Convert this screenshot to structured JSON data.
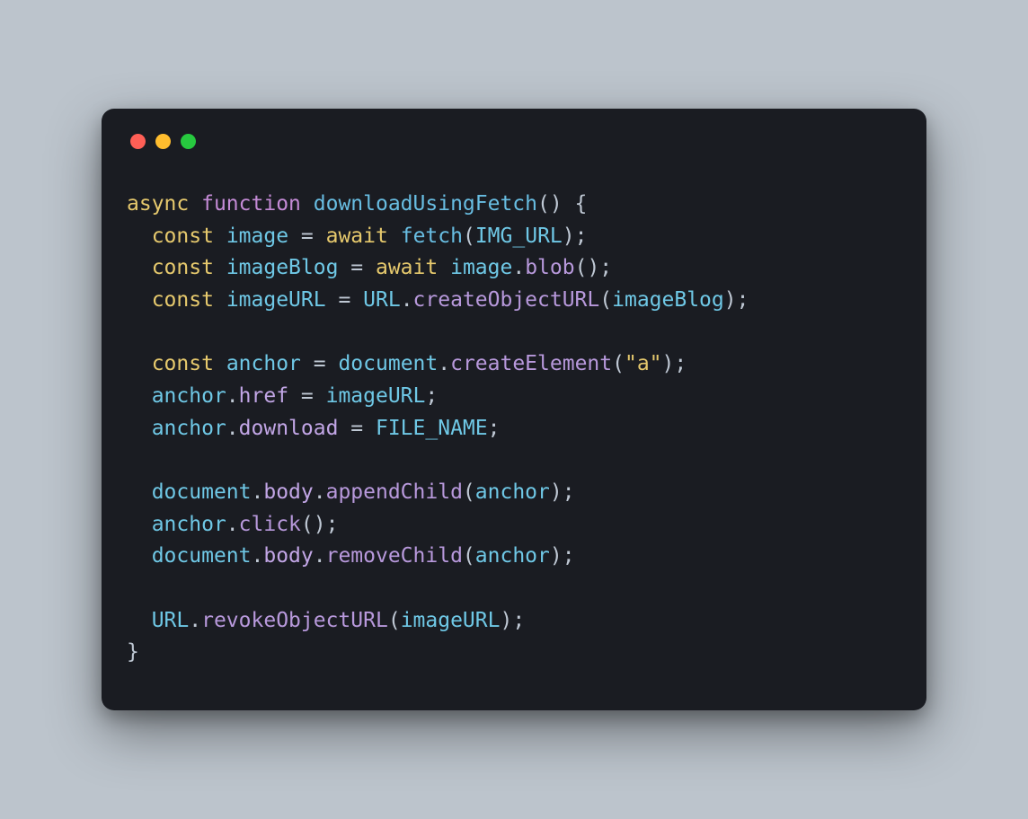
{
  "colors": {
    "background": "#bcc4cc",
    "window": "#1a1c22",
    "red": "#ff5f56",
    "yellow": "#ffbd2e",
    "green": "#27c93f"
  },
  "code": {
    "lines": [
      [
        {
          "t": "async",
          "c": "tok-kw2"
        },
        {
          "t": " ",
          "c": "tok-punc"
        },
        {
          "t": "function",
          "c": "tok-kw"
        },
        {
          "t": " ",
          "c": "tok-punc"
        },
        {
          "t": "downloadUsingFetch",
          "c": "tok-func"
        },
        {
          "t": "() {",
          "c": "tok-punc"
        }
      ],
      [
        {
          "t": "  ",
          "c": "tok-punc"
        },
        {
          "t": "const",
          "c": "tok-kw2"
        },
        {
          "t": " ",
          "c": "tok-punc"
        },
        {
          "t": "image",
          "c": "tok-ident"
        },
        {
          "t": " = ",
          "c": "tok-punc"
        },
        {
          "t": "await",
          "c": "tok-kw2"
        },
        {
          "t": " ",
          "c": "tok-punc"
        },
        {
          "t": "fetch",
          "c": "tok-func"
        },
        {
          "t": "(",
          "c": "tok-punc"
        },
        {
          "t": "IMG_URL",
          "c": "tok-const"
        },
        {
          "t": ");",
          "c": "tok-punc"
        }
      ],
      [
        {
          "t": "  ",
          "c": "tok-punc"
        },
        {
          "t": "const",
          "c": "tok-kw2"
        },
        {
          "t": " ",
          "c": "tok-punc"
        },
        {
          "t": "imageBlog",
          "c": "tok-ident"
        },
        {
          "t": " = ",
          "c": "tok-punc"
        },
        {
          "t": "await",
          "c": "tok-kw2"
        },
        {
          "t": " ",
          "c": "tok-punc"
        },
        {
          "t": "image",
          "c": "tok-ident"
        },
        {
          "t": ".",
          "c": "tok-punc"
        },
        {
          "t": "blob",
          "c": "tok-call"
        },
        {
          "t": "();",
          "c": "tok-punc"
        }
      ],
      [
        {
          "t": "  ",
          "c": "tok-punc"
        },
        {
          "t": "const",
          "c": "tok-kw2"
        },
        {
          "t": " ",
          "c": "tok-punc"
        },
        {
          "t": "imageURL",
          "c": "tok-ident"
        },
        {
          "t": " = ",
          "c": "tok-punc"
        },
        {
          "t": "URL",
          "c": "tok-doc"
        },
        {
          "t": ".",
          "c": "tok-punc"
        },
        {
          "t": "createObjectURL",
          "c": "tok-call"
        },
        {
          "t": "(",
          "c": "tok-punc"
        },
        {
          "t": "imageBlog",
          "c": "tok-ident"
        },
        {
          "t": ");",
          "c": "tok-punc"
        }
      ],
      [
        {
          "t": "",
          "c": "tok-punc"
        }
      ],
      [
        {
          "t": "  ",
          "c": "tok-punc"
        },
        {
          "t": "const",
          "c": "tok-kw2"
        },
        {
          "t": " ",
          "c": "tok-punc"
        },
        {
          "t": "anchor",
          "c": "tok-ident"
        },
        {
          "t": " = ",
          "c": "tok-punc"
        },
        {
          "t": "document",
          "c": "tok-doc"
        },
        {
          "t": ".",
          "c": "tok-punc"
        },
        {
          "t": "createElement",
          "c": "tok-call"
        },
        {
          "t": "(",
          "c": "tok-punc"
        },
        {
          "t": "\"a\"",
          "c": "tok-str"
        },
        {
          "t": ");",
          "c": "tok-punc"
        }
      ],
      [
        {
          "t": "  ",
          "c": "tok-punc"
        },
        {
          "t": "anchor",
          "c": "tok-ident"
        },
        {
          "t": ".",
          "c": "tok-punc"
        },
        {
          "t": "href",
          "c": "tok-prop"
        },
        {
          "t": " = ",
          "c": "tok-punc"
        },
        {
          "t": "imageURL",
          "c": "tok-ident"
        },
        {
          "t": ";",
          "c": "tok-punc"
        }
      ],
      [
        {
          "t": "  ",
          "c": "tok-punc"
        },
        {
          "t": "anchor",
          "c": "tok-ident"
        },
        {
          "t": ".",
          "c": "tok-punc"
        },
        {
          "t": "download",
          "c": "tok-prop"
        },
        {
          "t": " = ",
          "c": "tok-punc"
        },
        {
          "t": "FILE_NAME",
          "c": "tok-const"
        },
        {
          "t": ";",
          "c": "tok-punc"
        }
      ],
      [
        {
          "t": "",
          "c": "tok-punc"
        }
      ],
      [
        {
          "t": "  ",
          "c": "tok-punc"
        },
        {
          "t": "document",
          "c": "tok-doc"
        },
        {
          "t": ".",
          "c": "tok-punc"
        },
        {
          "t": "body",
          "c": "tok-prop"
        },
        {
          "t": ".",
          "c": "tok-punc"
        },
        {
          "t": "appendChild",
          "c": "tok-call"
        },
        {
          "t": "(",
          "c": "tok-punc"
        },
        {
          "t": "anchor",
          "c": "tok-ident"
        },
        {
          "t": ");",
          "c": "tok-punc"
        }
      ],
      [
        {
          "t": "  ",
          "c": "tok-punc"
        },
        {
          "t": "anchor",
          "c": "tok-ident"
        },
        {
          "t": ".",
          "c": "tok-punc"
        },
        {
          "t": "click",
          "c": "tok-call"
        },
        {
          "t": "();",
          "c": "tok-punc"
        }
      ],
      [
        {
          "t": "  ",
          "c": "tok-punc"
        },
        {
          "t": "document",
          "c": "tok-doc"
        },
        {
          "t": ".",
          "c": "tok-punc"
        },
        {
          "t": "body",
          "c": "tok-prop"
        },
        {
          "t": ".",
          "c": "tok-punc"
        },
        {
          "t": "removeChild",
          "c": "tok-call"
        },
        {
          "t": "(",
          "c": "tok-punc"
        },
        {
          "t": "anchor",
          "c": "tok-ident"
        },
        {
          "t": ");",
          "c": "tok-punc"
        }
      ],
      [
        {
          "t": "",
          "c": "tok-punc"
        }
      ],
      [
        {
          "t": "  ",
          "c": "tok-punc"
        },
        {
          "t": "URL",
          "c": "tok-doc"
        },
        {
          "t": ".",
          "c": "tok-punc"
        },
        {
          "t": "revokeObjectURL",
          "c": "tok-call"
        },
        {
          "t": "(",
          "c": "tok-punc"
        },
        {
          "t": "imageURL",
          "c": "tok-ident"
        },
        {
          "t": ");",
          "c": "tok-punc"
        }
      ],
      [
        {
          "t": "}",
          "c": "tok-punc"
        }
      ]
    ]
  }
}
